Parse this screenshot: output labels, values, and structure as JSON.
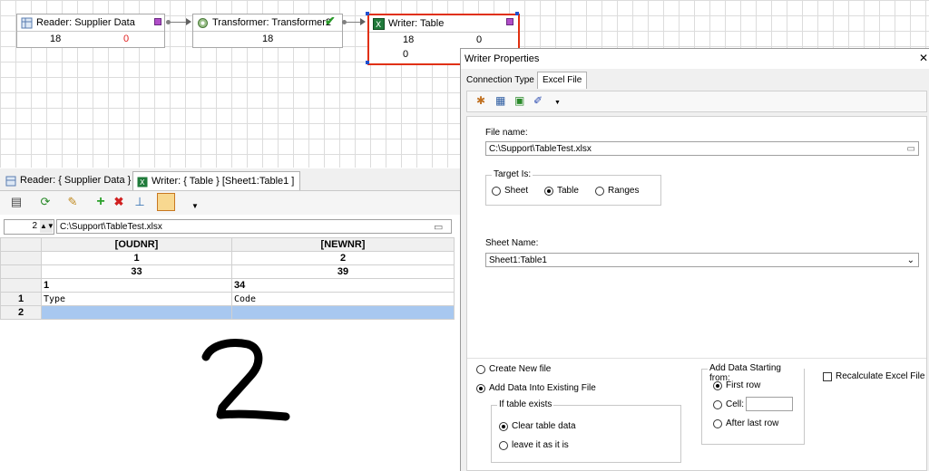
{
  "workflow": {
    "reader": {
      "title": "Reader: Supplier Data",
      "count_ok": "18",
      "count_rejected": "0"
    },
    "transformer": {
      "title": "Transformer: Transformer2",
      "count": "18"
    },
    "writer": {
      "title": "Writer: Table",
      "count_a": "18",
      "count_b": "0",
      "count_c": "0"
    }
  },
  "tabs": [
    {
      "label": "Reader: { Supplier Data }"
    },
    {
      "label": "Writer: { Table } [Sheet1:Table1 ]"
    }
  ],
  "pathbar": {
    "row_number": "2",
    "path": "C:\\Support\\TableTest.xlsx"
  },
  "table": {
    "columns": [
      "[OUDNR]",
      "[NEWNR]"
    ],
    "rows": [
      [
        "",
        "1",
        "2"
      ],
      [
        "",
        "33",
        "39"
      ],
      [
        "",
        "1",
        "34"
      ],
      [
        "1",
        "Type",
        "Code"
      ],
      [
        "2",
        "",
        ""
      ]
    ]
  },
  "dialog": {
    "title": "Writer Properties",
    "tabs": [
      "Connection Type",
      "Excel File"
    ],
    "file_name_label": "File name:",
    "file_name_value": "C:\\Support\\TableTest.xlsx",
    "target_label": "Target Is:",
    "target_options": [
      "Sheet",
      "Table",
      "Ranges"
    ],
    "target_selected": "Table",
    "sheet_name_label": "Sheet Name:",
    "sheet_name_value": "Sheet1:Table1",
    "create_new_file": "Create New file",
    "add_data_existing": "Add Data Into Existing File",
    "if_table_exists_label": "If table exists",
    "clear_table_data": "Clear table data",
    "leave_it": "leave it as it is",
    "add_data_starting_label": "Add Data Starting from:",
    "first_row": "First row",
    "cell_label": "Cell:",
    "after_last_row": "After last row",
    "recalculate": "Recalculate Excel File"
  },
  "colors": {
    "selection": "#e03010",
    "port": "#b04ec8",
    "highlight_row": "#a8c8f0"
  }
}
